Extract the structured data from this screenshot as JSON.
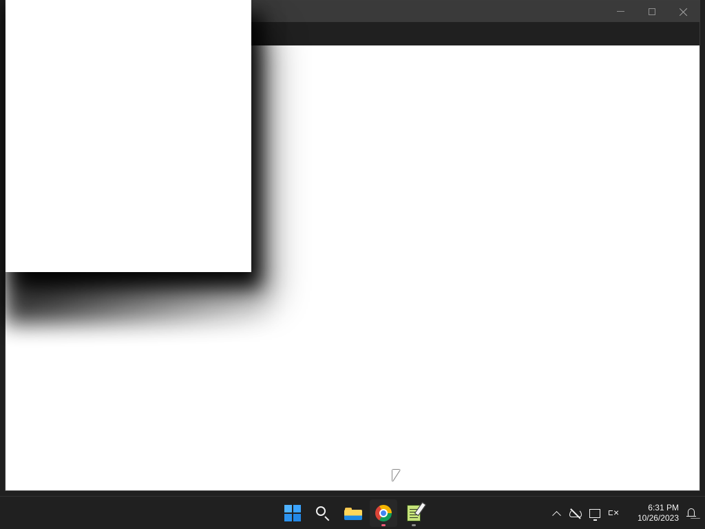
{
  "window": {
    "controls": {
      "minimize_label": "",
      "maximize_label": "",
      "close_label": ""
    }
  },
  "taskbar": {
    "apps": [
      {
        "name": "Start",
        "icon": "windows-logo-icon",
        "running": false
      },
      {
        "name": "Search",
        "icon": "search-icon",
        "running": false
      },
      {
        "name": "File Explorer",
        "icon": "folder-icon",
        "running": false
      },
      {
        "name": "Google Chrome",
        "icon": "chrome-icon",
        "running": true,
        "active": true
      },
      {
        "name": "Notepad",
        "icon": "notepad-icon",
        "running": true
      }
    ],
    "tray": {
      "icons": [
        "chevron-up-icon",
        "cloud-off-icon",
        "network-icon",
        "volume-muted-icon",
        "bell-icon"
      ],
      "time": "6:31 PM",
      "date": "10/26/2023"
    }
  },
  "colors": {
    "titlebar": "#3a3a3a",
    "toolbar": "#202020",
    "taskbar": "#202020",
    "window_background": "#ffffff",
    "windows_blue": "#3ba7ff",
    "chrome_indicator": "#f05a79"
  }
}
